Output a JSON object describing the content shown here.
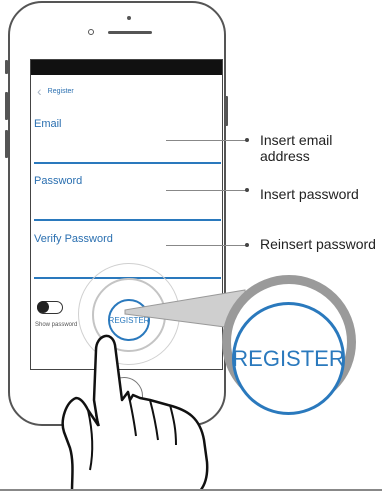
{
  "screen": {
    "header": {
      "back_icon": "chevron-left-icon",
      "title": "Register"
    },
    "fields": [
      {
        "label": "Email"
      },
      {
        "label": "Password"
      },
      {
        "label": "Verify Password"
      }
    ],
    "toggle": {
      "label": "Show password",
      "state": "off"
    },
    "register_button": {
      "label": "REGISTER"
    }
  },
  "annotations": {
    "email": [
      "Insert email",
      "address"
    ],
    "password": "Insert password",
    "verify": "Reinsert password"
  },
  "zoom": {
    "label": "REGISTER"
  },
  "colors": {
    "accent": "#2a79bd",
    "frame": "#555555",
    "zoom_ring": "#9a9a9a"
  }
}
